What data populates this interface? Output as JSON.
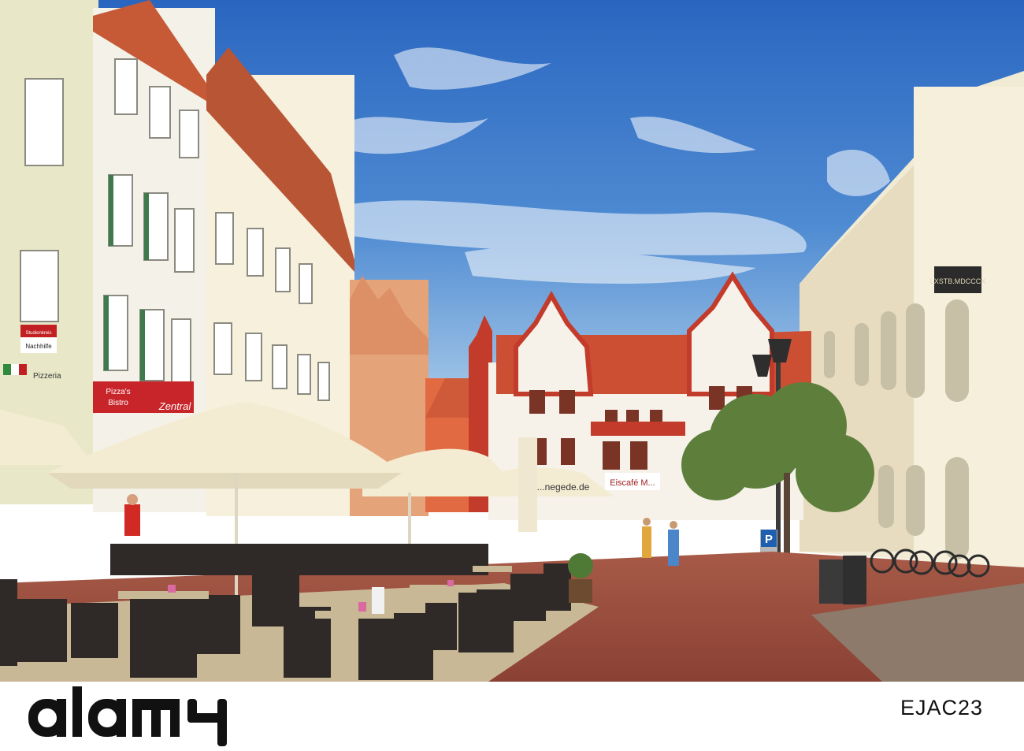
{
  "photo": {
    "signs": {
      "studie": "Studienkreis",
      "nachhilfe": "Nachhilfe",
      "pizza_line1": "Pizza's",
      "pizza_line2": "Bistro",
      "zentral": "Zentral",
      "pizzeria": "Pizzeria",
      "umbrella": "...negede.de",
      "eiscafe": "Eiscafé M...",
      "inscription": "LXSTB.MDCCCX",
      "parking": "P"
    }
  },
  "watermark": {
    "logo_text": "alamy",
    "stock_id": "EJAC23"
  },
  "colors": {
    "sky_top": "#2f6fc4",
    "sky_bottom": "#9cc3e8",
    "gable_red": "#c9412b",
    "roof": "#c4552f",
    "pavement": "#9b4d3e",
    "umbrella": "#f4ecd2"
  }
}
